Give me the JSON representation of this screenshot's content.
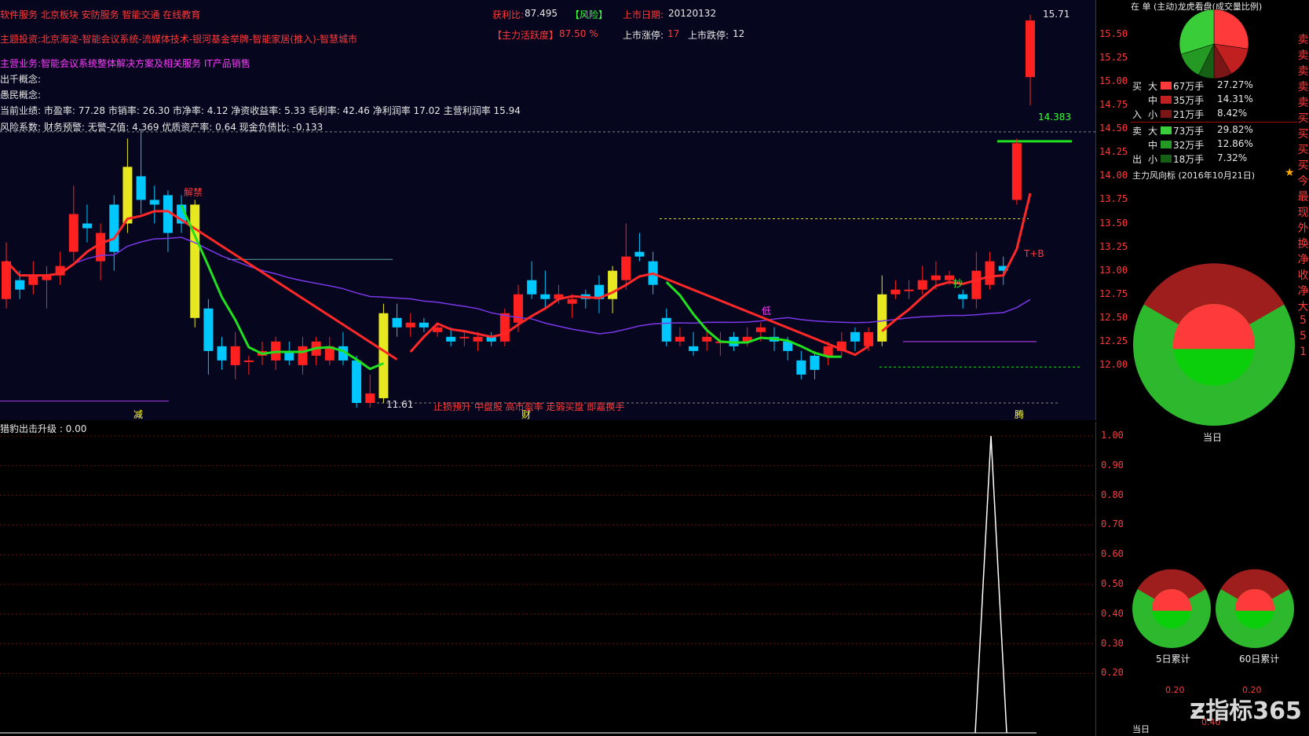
{
  "header": {
    "row1_left": "软件服务 北京板块 安防服务 智能交通 在线教育",
    "profit_ratio_label": "获利比:",
    "profit_ratio_value": "87.495",
    "risk_tag": "【风险】",
    "listing_date_label": "上市日期:",
    "listing_date_value": "20120132",
    "main_activity_label": "【主力活跃度】",
    "main_activity_value": "87.50 %",
    "listing_limit_up_label": "上市涨停:",
    "listing_limit_up_value": "17",
    "listing_limit_down_label": "上市跌停:",
    "listing_limit_down_value": "12",
    "theme_investment": "主题投资:北京海淀-智能会议系统-流媒体技术-银河基金举牌-智能家居(推入)-智慧城市",
    "main_business": "主营业务:智能会议系统整体解决方案及相关服务 IT产品销售",
    "qianjia_concept": "出千概念:",
    "simin_concept": "愚民概念:",
    "current_performance": "当前业绩: 市盈率: 77.28 市销率: 26.30 市净率: 4.12 净资收益率: 5.33 毛利率: 42.46 净利润率 17.02 主营利润率 15.94",
    "risk_factor": "风险系数: 财务预警: 无警-Z值: 4.369 优质资产率: 0.64 现金负债比: -0.133"
  },
  "main_chart": {
    "annotations": {
      "high_price": "15.71",
      "low_price": "11.61",
      "target_price": "14.383",
      "bottom_banner": "止损预升 中盘股 高市盈率 走弱买盘 即嘉换手",
      "marker_jian": "减",
      "marker_cai": "财",
      "marker_teng": "腾",
      "marker_jieti": "解禁",
      "marker_diyi": "低",
      "marker_chao": "抄",
      "marker_tp": "T+B"
    },
    "y_ticks": [
      "15.50",
      "15.25",
      "15.00",
      "14.75",
      "14.50",
      "14.25",
      "14.00",
      "13.75",
      "13.50",
      "13.25",
      "13.00",
      "12.75",
      "12.50",
      "12.25",
      "12.00"
    ]
  },
  "chart_data": {
    "type": "candlestick",
    "title": "",
    "ylim": [
      11.5,
      15.8
    ],
    "candles": [
      {
        "o": 12.7,
        "c": 13.1,
        "h": 13.3,
        "l": 12.6
      },
      {
        "o": 12.9,
        "c": 12.8,
        "h": 13.0,
        "l": 12.7
      },
      {
        "o": 12.85,
        "c": 12.95,
        "h": 13.1,
        "l": 12.75
      },
      {
        "o": 12.9,
        "c": 12.95,
        "h": 13.05,
        "l": 12.6
      },
      {
        "o": 12.95,
        "c": 13.05,
        "h": 13.2,
        "l": 12.85
      },
      {
        "o": 13.2,
        "c": 13.6,
        "h": 13.9,
        "l": 13.1
      },
      {
        "o": 13.5,
        "c": 13.45,
        "h": 13.7,
        "l": 13.3
      },
      {
        "o": 13.1,
        "c": 13.4,
        "h": 13.5,
        "l": 12.9
      },
      {
        "o": 13.7,
        "c": 13.2,
        "h": 13.8,
        "l": 13.0
      },
      {
        "o": 13.5,
        "c": 14.1,
        "h": 14.4,
        "l": 13.4
      },
      {
        "o": 14.0,
        "c": 13.75,
        "h": 14.5,
        "l": 13.6
      },
      {
        "o": 13.75,
        "c": 13.7,
        "h": 13.9,
        "l": 13.5
      },
      {
        "o": 13.8,
        "c": 13.4,
        "h": 13.85,
        "l": 13.2
      },
      {
        "o": 13.7,
        "c": 13.5,
        "h": 13.8,
        "l": 13.4
      },
      {
        "o": 13.7,
        "c": 12.5,
        "h": 13.75,
        "l": 12.4
      },
      {
        "o": 12.6,
        "c": 12.15,
        "h": 12.7,
        "l": 11.9
      },
      {
        "o": 12.2,
        "c": 12.05,
        "h": 12.3,
        "l": 11.95
      },
      {
        "o": 12.0,
        "c": 12.2,
        "h": 12.35,
        "l": 11.85
      },
      {
        "o": 12.05,
        "c": 12.05,
        "h": 12.1,
        "l": 11.9
      },
      {
        "o": 12.1,
        "c": 12.15,
        "h": 12.25,
        "l": 12.0
      },
      {
        "o": 12.05,
        "c": 12.25,
        "h": 12.3,
        "l": 11.95
      },
      {
        "o": 12.15,
        "c": 12.05,
        "h": 12.25,
        "l": 12.0
      },
      {
        "o": 12.0,
        "c": 12.2,
        "h": 12.3,
        "l": 11.9
      },
      {
        "o": 12.1,
        "c": 12.25,
        "h": 12.3,
        "l": 12.0
      },
      {
        "o": 12.05,
        "c": 12.2,
        "h": 12.3,
        "l": 12.0
      },
      {
        "o": 12.2,
        "c": 12.05,
        "h": 12.35,
        "l": 12.0
      },
      {
        "o": 12.05,
        "c": 11.6,
        "h": 12.1,
        "l": 11.55
      },
      {
        "o": 11.6,
        "c": 11.7,
        "h": 11.9,
        "l": 11.55
      },
      {
        "o": 11.65,
        "c": 12.55,
        "h": 12.65,
        "l": 11.6
      },
      {
        "o": 12.5,
        "c": 12.4,
        "h": 12.65,
        "l": 12.3
      },
      {
        "o": 12.4,
        "c": 12.45,
        "h": 12.55,
        "l": 12.3
      },
      {
        "o": 12.45,
        "c": 12.4,
        "h": 12.5,
        "l": 12.35
      },
      {
        "o": 12.35,
        "c": 12.4,
        "h": 12.45,
        "l": 12.3
      },
      {
        "o": 12.3,
        "c": 12.25,
        "h": 12.4,
        "l": 12.2
      },
      {
        "o": 12.3,
        "c": 12.3,
        "h": 12.35,
        "l": 12.2
      },
      {
        "o": 12.25,
        "c": 12.3,
        "h": 12.35,
        "l": 12.15
      },
      {
        "o": 12.3,
        "c": 12.25,
        "h": 12.35,
        "l": 12.2
      },
      {
        "o": 12.25,
        "c": 12.55,
        "h": 12.6,
        "l": 12.2
      },
      {
        "o": 12.45,
        "c": 12.75,
        "h": 12.85,
        "l": 12.35
      },
      {
        "o": 12.9,
        "c": 12.75,
        "h": 13.1,
        "l": 12.7
      },
      {
        "o": 12.75,
        "c": 12.7,
        "h": 13.0,
        "l": 12.6
      },
      {
        "o": 12.7,
        "c": 12.75,
        "h": 12.85,
        "l": 12.65
      },
      {
        "o": 12.65,
        "c": 12.7,
        "h": 12.75,
        "l": 12.5
      },
      {
        "o": 12.75,
        "c": 12.7,
        "h": 12.8,
        "l": 12.6
      },
      {
        "o": 12.85,
        "c": 12.7,
        "h": 12.95,
        "l": 12.55
      },
      {
        "o": 12.7,
        "c": 13.0,
        "h": 13.05,
        "l": 12.55
      },
      {
        "o": 12.9,
        "c": 13.15,
        "h": 13.5,
        "l": 12.8
      },
      {
        "o": 13.2,
        "c": 13.15,
        "h": 13.4,
        "l": 13.1
      },
      {
        "o": 13.1,
        "c": 12.85,
        "h": 13.2,
        "l": 12.75
      },
      {
        "o": 12.5,
        "c": 12.25,
        "h": 12.6,
        "l": 12.2
      },
      {
        "o": 12.25,
        "c": 12.3,
        "h": 12.4,
        "l": 12.2
      },
      {
        "o": 12.2,
        "c": 12.15,
        "h": 12.35,
        "l": 12.1
      },
      {
        "o": 12.25,
        "c": 12.3,
        "h": 12.4,
        "l": 12.15
      },
      {
        "o": 12.25,
        "c": 12.25,
        "h": 12.35,
        "l": 12.1
      },
      {
        "o": 12.3,
        "c": 12.2,
        "h": 12.35,
        "l": 12.15
      },
      {
        "o": 12.25,
        "c": 12.3,
        "h": 12.4,
        "l": 12.2
      },
      {
        "o": 12.35,
        "c": 12.4,
        "h": 12.45,
        "l": 12.25
      },
      {
        "o": 12.3,
        "c": 12.25,
        "h": 12.4,
        "l": 12.15
      },
      {
        "o": 12.25,
        "c": 12.15,
        "h": 12.3,
        "l": 12.05
      },
      {
        "o": 12.05,
        "c": 11.9,
        "h": 12.15,
        "l": 11.85
      },
      {
        "o": 12.1,
        "c": 11.95,
        "h": 12.15,
        "l": 11.85
      },
      {
        "o": 12.1,
        "c": 12.2,
        "h": 12.25,
        "l": 12.0
      },
      {
        "o": 12.15,
        "c": 12.25,
        "h": 12.35,
        "l": 12.1
      },
      {
        "o": 12.35,
        "c": 12.25,
        "h": 12.4,
        "l": 12.15
      },
      {
        "o": 12.2,
        "c": 12.35,
        "h": 12.4,
        "l": 12.15
      },
      {
        "o": 12.25,
        "c": 12.75,
        "h": 12.95,
        "l": 12.2
      },
      {
        "o": 12.75,
        "c": 12.8,
        "h": 12.9,
        "l": 12.7
      },
      {
        "o": 12.8,
        "c": 12.8,
        "h": 12.9,
        "l": 12.7
      },
      {
        "o": 12.8,
        "c": 12.9,
        "h": 13.05,
        "l": 12.75
      },
      {
        "o": 12.9,
        "c": 12.95,
        "h": 13.1,
        "l": 12.8
      },
      {
        "o": 12.9,
        "c": 12.95,
        "h": 13.0,
        "l": 12.85
      },
      {
        "o": 12.75,
        "c": 12.7,
        "h": 12.8,
        "l": 12.6
      },
      {
        "o": 12.7,
        "c": 13.0,
        "h": 13.2,
        "l": 12.6
      },
      {
        "o": 12.85,
        "c": 13.1,
        "h": 13.2,
        "l": 12.8
      },
      {
        "o": 13.05,
        "c": 13.0,
        "h": 13.15,
        "l": 12.85
      },
      {
        "o": 13.75,
        "c": 14.35,
        "h": 14.4,
        "l": 13.7
      },
      {
        "o": 15.05,
        "c": 15.65,
        "h": 15.71,
        "l": 14.75
      }
    ],
    "ma_green_end": "12.28",
    "sub_indicator": {
      "name": "猎豹出击升级",
      "value": "0.00",
      "y_ticks": [
        "1.00",
        "0.90",
        "0.80",
        "0.70",
        "0.60",
        "0.50",
        "0.40",
        "0.30",
        "0.20"
      ],
      "ylim": [
        0.0,
        1.0
      ],
      "spike_value": 1.0
    }
  },
  "sub_chart": {
    "indicator_label": "猎豹出击升级 : 0.00"
  },
  "right_panel": {
    "top_label": "在  单  (主动)龙虎看盘(成交量比例)",
    "buy_in_header": "买",
    "in_label": "入",
    "sell_out_header": "卖",
    "out_label": "出",
    "flow_rows": [
      {
        "side": "买",
        "size": "大",
        "volume": "67万手",
        "pct": "27.27%",
        "color": "#ff3a3a"
      },
      {
        "side": "",
        "size": "中",
        "volume": "35万手",
        "pct": "14.31%",
        "color": "#c02020"
      },
      {
        "side": "入",
        "size": "小",
        "volume": "21万手",
        "pct": "8.42%",
        "color": "#7a1616"
      },
      {
        "side": "卖",
        "size": "大",
        "volume": "73万手",
        "pct": "29.82%",
        "color": "#3acd3a"
      },
      {
        "side": "",
        "size": "中",
        "volume": "32万手",
        "pct": "12.86%",
        "color": "#249a24"
      },
      {
        "side": "出",
        "size": "小",
        "volume": "18万手",
        "pct": "7.32%",
        "color": "#166016"
      }
    ],
    "main_force_label": "主力风向标 (2016年10月21日)",
    "today_label": "当日",
    "pie5_label": "5日累计",
    "pie60_label": "60日累计",
    "bottom_tick_a": "0.20",
    "bottom_tick_b": "0.20",
    "bottom_tick_c": "0.40",
    "bottom_left": "当日"
  },
  "far_strip": [
    "卖",
    "卖",
    "卖",
    "卖",
    "卖",
    "买",
    "买",
    "买",
    "买",
    "今",
    "最",
    "现",
    "外",
    "换",
    "净",
    "收",
    "净",
    "大",
    "5",
    "5",
    "1"
  ],
  "watermark": "指标365",
  "colors": {
    "up_candle": "#ff2020",
    "down_candle": "#00c8ff",
    "yellow_candle": "#e8e820",
    "ma_red": "#ff2828",
    "ma_green": "#20e020",
    "ma_purple": "#7a38e8"
  }
}
